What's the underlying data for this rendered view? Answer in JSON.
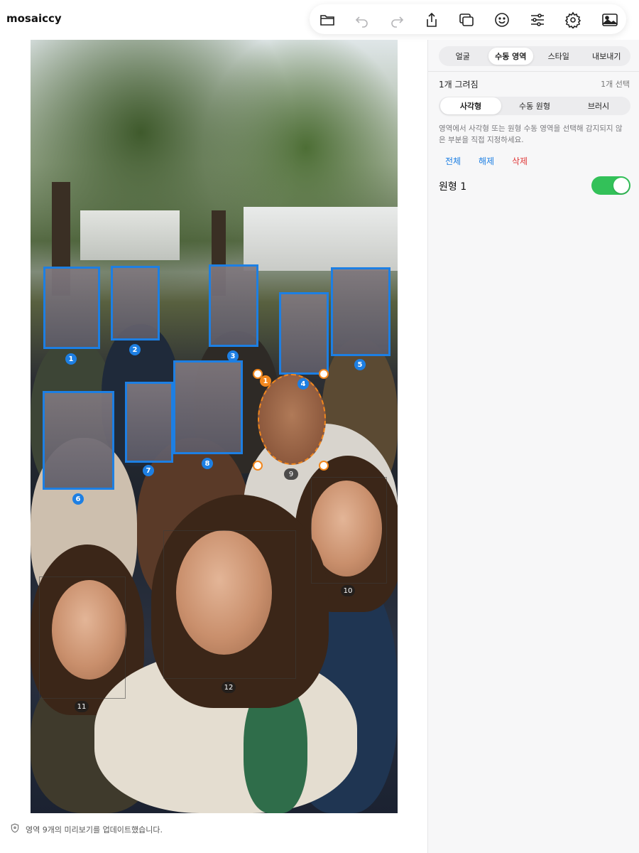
{
  "app": {
    "title": "mosaiccy"
  },
  "toolbar": {
    "icons": [
      "folder-icon",
      "undo-icon",
      "redo-icon",
      "share-icon",
      "duplicate-icon",
      "face-icon",
      "sliders-icon",
      "gear-icon",
      "image-icon"
    ]
  },
  "panel": {
    "tabs": [
      {
        "label": "얼굴",
        "active": false
      },
      {
        "label": "수동 영역",
        "active": true
      },
      {
        "label": "스타일",
        "active": false
      },
      {
        "label": "내보내기",
        "active": false
      }
    ],
    "drawn_count": "1개 그려짐",
    "selected_count": "1개 선택",
    "shape_tabs": [
      {
        "label": "사각형",
        "active": true
      },
      {
        "label": "수동 원형",
        "active": false
      },
      {
        "label": "브러시",
        "active": false
      }
    ],
    "description": "영역에서 사각형 또는 원형 수동 영역을 선택해 감지되지 않은 부분을 직접 지정하세요.",
    "actions": {
      "all": "전체",
      "release": "해제",
      "delete": "삭제"
    },
    "region_item": {
      "label": "원형 1",
      "enabled": true
    }
  },
  "canvas": {
    "mosaic_labels": [
      "1",
      "2",
      "3",
      "4",
      "5",
      "6",
      "7",
      "8"
    ],
    "face_labels": [
      "9",
      "10",
      "11",
      "12"
    ],
    "manual_label": "1"
  },
  "status": {
    "message": "영역 9개의 미리보기를 업데이트했습니다."
  },
  "colors": {
    "accent": "#1d7fe3",
    "manual": "#f2871d",
    "delete": "#e03a3a",
    "toggle_on": "#33c159"
  }
}
